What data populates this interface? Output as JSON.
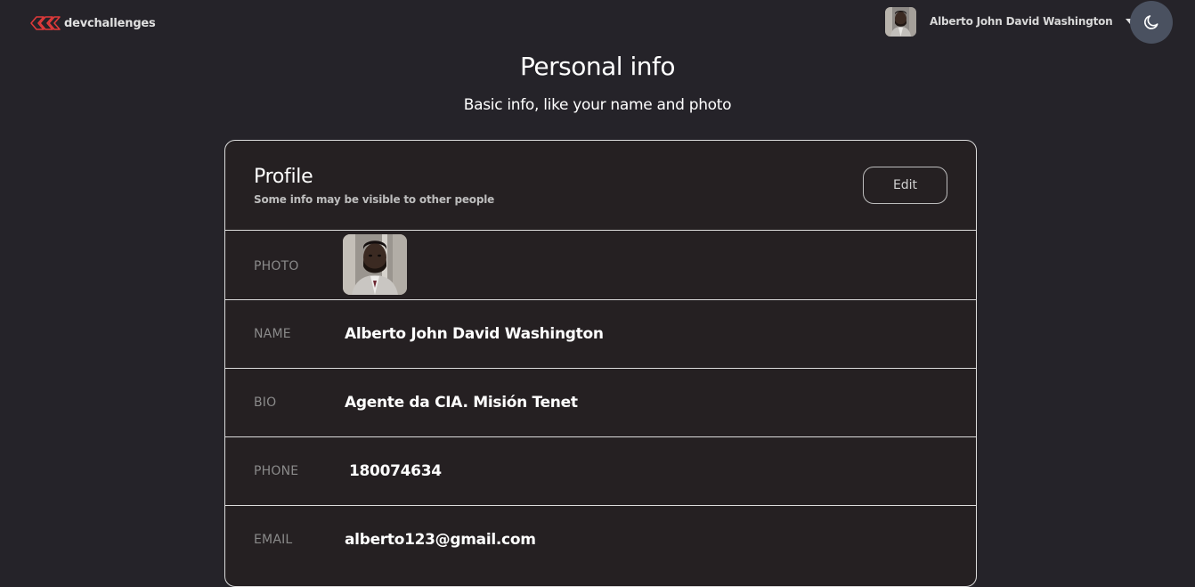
{
  "header": {
    "brand_name": "devchallenges",
    "user_name": "Alberto John David Washington",
    "icons": {
      "logo": "devchallenges-logo-icon",
      "avatar": "user-avatar",
      "menu": "caret-down-icon",
      "theme": "moon-icon"
    }
  },
  "page": {
    "title": "Personal info",
    "subtitle": "Basic info, like your name and photo"
  },
  "profile": {
    "title": "Profile",
    "description": "Some info may be visible to other people",
    "edit_label": "Edit",
    "rows": {
      "photo": {
        "label": "PHOTO"
      },
      "name": {
        "label": "NAME",
        "value": "Alberto John David Washington"
      },
      "bio": {
        "label": "BIO",
        "value": "Agente da CIA. Misión Tenet"
      },
      "phone": {
        "label": "PHONE",
        "value": "180074634"
      },
      "email": {
        "label": "EMAIL",
        "value": "alberto123@gmail.com"
      }
    }
  },
  "colors": {
    "background": "#252329",
    "card_background": "#252022",
    "card_border": "#dcdcdc",
    "label_text": "#8a8a8a",
    "brand_accent": "#e03a3a",
    "theme_button": "#4a5160"
  }
}
